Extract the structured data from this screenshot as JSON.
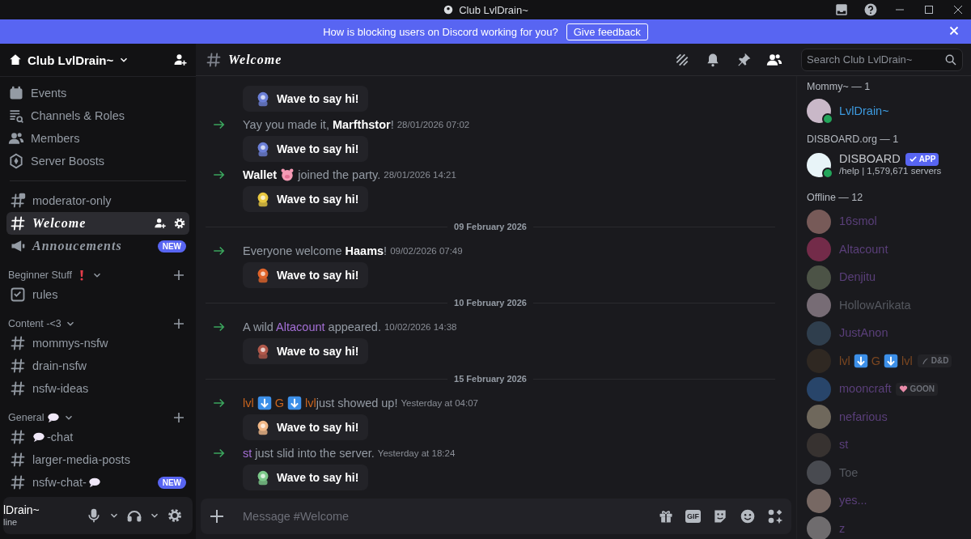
{
  "window": {
    "title": "Club LvlDrain~"
  },
  "banner": {
    "text": "How is blocking users on Discord working for you?",
    "button": "Give feedback"
  },
  "server": {
    "name": "Club LvlDrain~"
  },
  "menu": [
    {
      "kind": "events",
      "label": "Events"
    },
    {
      "kind": "roles",
      "label": "Channels & Roles"
    },
    {
      "kind": "members",
      "label": "Members"
    },
    {
      "kind": "boosts",
      "label": "Server Boosts"
    }
  ],
  "sections": [
    {
      "channels": [
        {
          "kind": "hash-lock",
          "name": "moderator-only",
          "selected": false
        },
        {
          "kind": "hash-fancy",
          "name": "Welcome",
          "selected": true
        },
        {
          "kind": "announce",
          "name": "Annoucements",
          "selected": false,
          "badge": "NEW"
        }
      ]
    },
    {
      "category": "Beginner Stuff",
      "channels": [
        {
          "kind": "rules",
          "name": "rules",
          "selected": false
        }
      ]
    },
    {
      "category": "Content -<3",
      "channels": [
        {
          "kind": "hash",
          "name": "mommys-nsfw",
          "selected": false
        },
        {
          "kind": "hash",
          "name": "drain-nsfw",
          "selected": false
        },
        {
          "kind": "hash",
          "name": "nsfw-ideas",
          "selected": false
        }
      ]
    },
    {
      "category": "General",
      "channels": [
        {
          "kind": "hash-emoji-start",
          "name": "-chat",
          "selected": false
        },
        {
          "kind": "hash",
          "name": "larger-media-posts",
          "selected": false
        },
        {
          "kind": "hash-emoji-end",
          "name": "nsfw-chat-",
          "selected": false,
          "badge": "NEW"
        }
      ]
    }
  ],
  "user": {
    "name": "lDrain~",
    "status": "line"
  },
  "channel": {
    "name": "Welcome"
  },
  "search": {
    "placeholder": "Search Club LvlDrain~"
  },
  "messages": [
    {
      "kind": "wave",
      "wave": "Wave to say hi!"
    },
    {
      "kind": "join",
      "parts": [
        {
          "kind": "text",
          "text": "Yay you made it, "
        },
        {
          "kind": "name",
          "text": "Marfthstor"
        },
        {
          "kind": "text",
          "text": "!"
        }
      ],
      "time": "28/01/2026 07:02",
      "wave": "Wave to say hi!"
    },
    {
      "kind": "join",
      "parts": [
        {
          "kind": "name",
          "text": "Wallet"
        },
        {
          "kind": "pig-emoji"
        },
        {
          "kind": "text",
          "text": "joined the party."
        }
      ],
      "time": "28/01/2026 14:21",
      "wave": "Wave to say hi!"
    },
    {
      "kind": "divider",
      "text": "09 February 2026"
    },
    {
      "kind": "join",
      "parts": [
        {
          "kind": "text",
          "text": "Everyone welcome "
        },
        {
          "kind": "name",
          "text": "Haams"
        },
        {
          "kind": "text",
          "text": "!"
        }
      ],
      "time": "09/02/2026 07:49",
      "wave": "Wave to say hi!"
    },
    {
      "kind": "divider",
      "text": "10 February 2026"
    },
    {
      "kind": "join",
      "parts": [
        {
          "kind": "text",
          "text": "A wild "
        },
        {
          "kind": "name",
          "text": "Altacount",
          "color": "#a46fd6"
        },
        {
          "kind": "text",
          "text": " appeared."
        }
      ],
      "time": "10/02/2026 14:38",
      "wave": "Wave to say hi!"
    },
    {
      "kind": "divider",
      "text": "15 February 2026"
    },
    {
      "kind": "join",
      "parts": [
        {
          "kind": "name",
          "text": "lvl",
          "color": "#c8641e"
        },
        {
          "kind": "down-emoji"
        },
        {
          "kind": "name",
          "text": "G",
          "color": "#c8641e"
        },
        {
          "kind": "down-emoji"
        },
        {
          "kind": "name",
          "text": "lvl",
          "color": "#c8641e"
        },
        {
          "kind": "text",
          "text": "just showed up!"
        }
      ],
      "time": "Yesterday at 04:07",
      "wave": "Wave to say hi!"
    },
    {
      "kind": "join",
      "parts": [
        {
          "kind": "name",
          "text": "st",
          "color": "#a46fd6"
        },
        {
          "kind": "text",
          "text": " just slid into the server."
        }
      ],
      "time": "Yesterday at 18:24",
      "wave": "Wave to say hi!"
    }
  ],
  "composer": {
    "placeholder": "Message #Welcome",
    "gif": "GIF"
  },
  "members": [
    {
      "group": "Mommy~ — 1",
      "items": [
        {
          "name": "LvlDrain~",
          "color": "#3d9be0",
          "online": true
        }
      ]
    },
    {
      "group": "DISBOARD.org — 1",
      "items": [
        {
          "name": "DISBOARD",
          "color": "#c4c7cc",
          "online": true,
          "tag": {
            "kind": "app",
            "text": "APP"
          },
          "status": "/help | 1,579,671 servers"
        }
      ]
    },
    {
      "group": "Offline — 12",
      "items": [
        {
          "name": "16smol",
          "color": "#5a3f7a",
          "online": false
        },
        {
          "name": "Altacount",
          "color": "#5a3f7a",
          "online": false
        },
        {
          "name": "Denjitu",
          "color": "#5a3f7a",
          "online": false
        },
        {
          "name": "HollowArikata",
          "color": "#55585f",
          "online": false
        },
        {
          "name": "JustAnon",
          "color": "#5a3f7a",
          "online": false
        },
        {
          "parts": [
            {
              "kind": "name",
              "text": "lvl"
            },
            {
              "kind": "down-emoji"
            },
            {
              "kind": "name",
              "text": "G"
            },
            {
              "kind": "down-emoji"
            },
            {
              "kind": "name",
              "text": "lvl"
            }
          ],
          "color": "#7a4620",
          "online": false,
          "tag": {
            "kind": "pen",
            "text": "D&D"
          }
        },
        {
          "name": "mooncraft",
          "color": "#5a3f7a",
          "online": false,
          "tag": {
            "kind": "heart",
            "text": "GOON"
          }
        },
        {
          "name": "nefarious",
          "color": "#5a3f7a",
          "online": false
        },
        {
          "name": "st",
          "color": "#5a3f7a",
          "online": false
        },
        {
          "name": "Toe",
          "color": "#55585f",
          "online": false
        },
        {
          "name": "yes...",
          "color": "#5a3f7a",
          "online": false
        },
        {
          "name": "z",
          "color": "#5a3f7a",
          "online": false
        }
      ]
    }
  ]
}
